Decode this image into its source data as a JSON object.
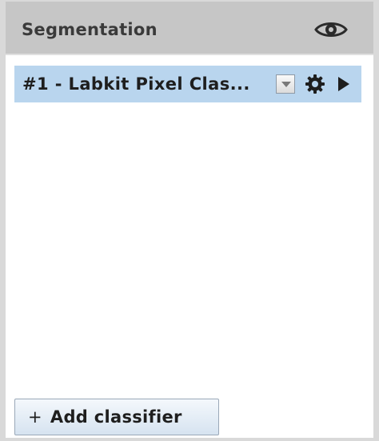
{
  "header": {
    "title": "Segmentation",
    "visibility_icon": "eye-icon"
  },
  "classifiers": [
    {
      "label": "#1 - Labkit Pixel Clas...",
      "selected": true,
      "dropdown_icon": "chevron-down-icon",
      "settings_icon": "gear-icon",
      "run_icon": "play-icon"
    }
  ],
  "footer": {
    "add_icon": "plus-icon",
    "add_label": "Add classifier"
  },
  "colors": {
    "header_bg": "#c6c6c6",
    "selected_row_bg": "#b9d5ee",
    "panel_border": "#d9d9d9"
  }
}
